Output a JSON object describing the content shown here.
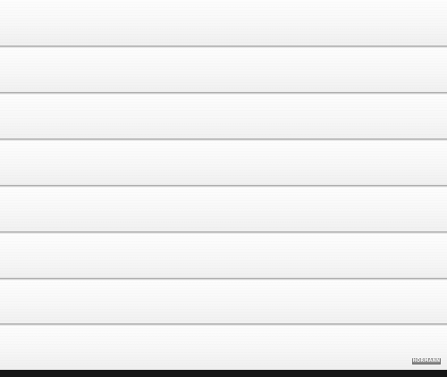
{
  "door": {
    "panel_count": 8,
    "brand": {
      "label": "HÖRMANN",
      "plate_color": "#8b8b8b"
    },
    "colors": {
      "panel": "#f6f6f6",
      "groove": "#9a9a9a",
      "bottom_rail": "#161616"
    }
  }
}
